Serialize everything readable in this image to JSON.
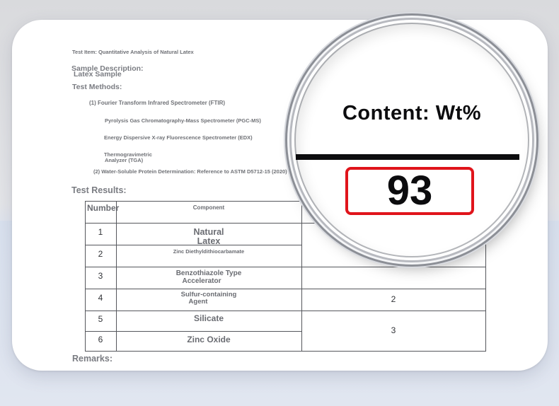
{
  "document": {
    "test_item": "Test Item: Quantitative Analysis of Natural Latex",
    "sample_description_heading": "Sample Description:",
    "sample_description_value": "Latex Sample",
    "test_methods_heading": "Test Methods:",
    "methods": {
      "m1": "(1) Fourier Transform Infrared Spectrometer (FTIR)",
      "m1a": "Pyrolysis Gas Chromatography-Mass Spectrometer (PGC-MS)",
      "m1b": "Energy Dispersive X-ray Fluorescence Spectrometer (EDX)",
      "m1c_line1": "Thermogravimetric",
      "m1c_line2": "Analyzer (TGA)",
      "m2": "(2) Water-Soluble Protein Determination: Reference to ASTM D5712-15 (2020)"
    },
    "test_results_heading": "Test Results:",
    "remarks_heading": "Remarks:"
  },
  "table": {
    "header_number": "Number",
    "header_component": "Component",
    "rows": [
      {
        "number": "1",
        "component_line1": "Natural",
        "component_line2": "Latex"
      },
      {
        "number": "2",
        "component_line1": "Zinc Diethyldithiocarbamate",
        "component_line2": ""
      },
      {
        "number": "3",
        "component_line1": "Benzothiazole Type",
        "component_line2": "Accelerator"
      },
      {
        "number": "4",
        "component_line1": "Sulfur-containing",
        "component_line2": "Agent"
      },
      {
        "number": "5",
        "component_line1": "Silicate",
        "component_line2": ""
      },
      {
        "number": "6",
        "component_line1": "Zinc Oxide",
        "component_line2": ""
      }
    ],
    "content_row4": "2",
    "content_rows56": "3"
  },
  "magnifier": {
    "title": "Content: Wt%",
    "value": "93",
    "highlight_color": "#e0141b"
  }
}
